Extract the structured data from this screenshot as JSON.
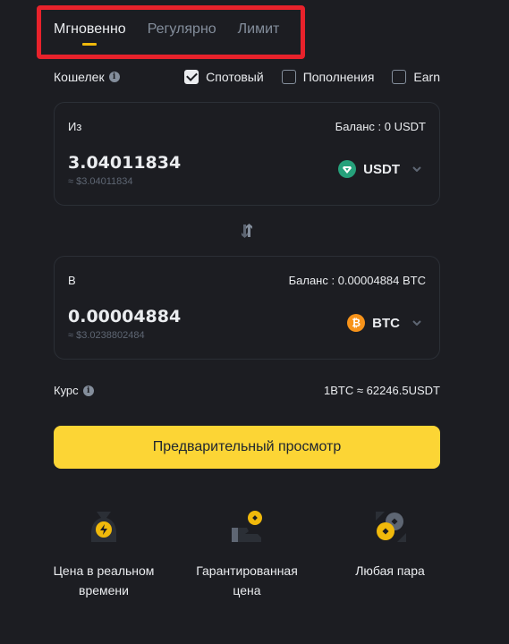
{
  "tabs": [
    {
      "label": "Мгновенно",
      "active": true
    },
    {
      "label": "Регулярно",
      "active": false
    },
    {
      "label": "Лимит",
      "active": false
    }
  ],
  "wallet": {
    "label": "Кошелек",
    "info_icon": "info-icon",
    "options": [
      {
        "label": "Спотовый",
        "checked": true
      },
      {
        "label": "Пополнения",
        "checked": false
      },
      {
        "label": "Earn",
        "checked": false
      }
    ]
  },
  "from": {
    "label": "Из",
    "balance": "Баланс : 0 USDT",
    "amount": "3.04011834",
    "approx": "≈ $3.04011834",
    "coin": "USDT",
    "coin_icon": "tether-icon",
    "coin_color": "#26a17b"
  },
  "swap_icon": "swap-arrows-icon",
  "to": {
    "label": "В",
    "balance": "Баланс : 0.00004884 BTC",
    "amount": "0.00004884",
    "approx": "≈ $3.0238802484",
    "coin": "BTC",
    "coin_icon": "bitcoin-icon",
    "coin_color": "#f7931a"
  },
  "rate": {
    "label": "Курс",
    "value": "1BTC ≈ 62246.5USDT"
  },
  "preview_button": "Предварительный просмотр",
  "features": [
    {
      "icon": "lightning-bag-icon",
      "text": "Цена в реальном времени"
    },
    {
      "icon": "hand-coin-icon",
      "text": "Гарантированная цена"
    },
    {
      "icon": "coins-pair-icon",
      "text": "Любая пара"
    }
  ],
  "colors": {
    "background": "#1c1d22",
    "accent": "#fcd535",
    "tab_indicator": "#f0b90b",
    "highlight_border": "#e8222b"
  }
}
